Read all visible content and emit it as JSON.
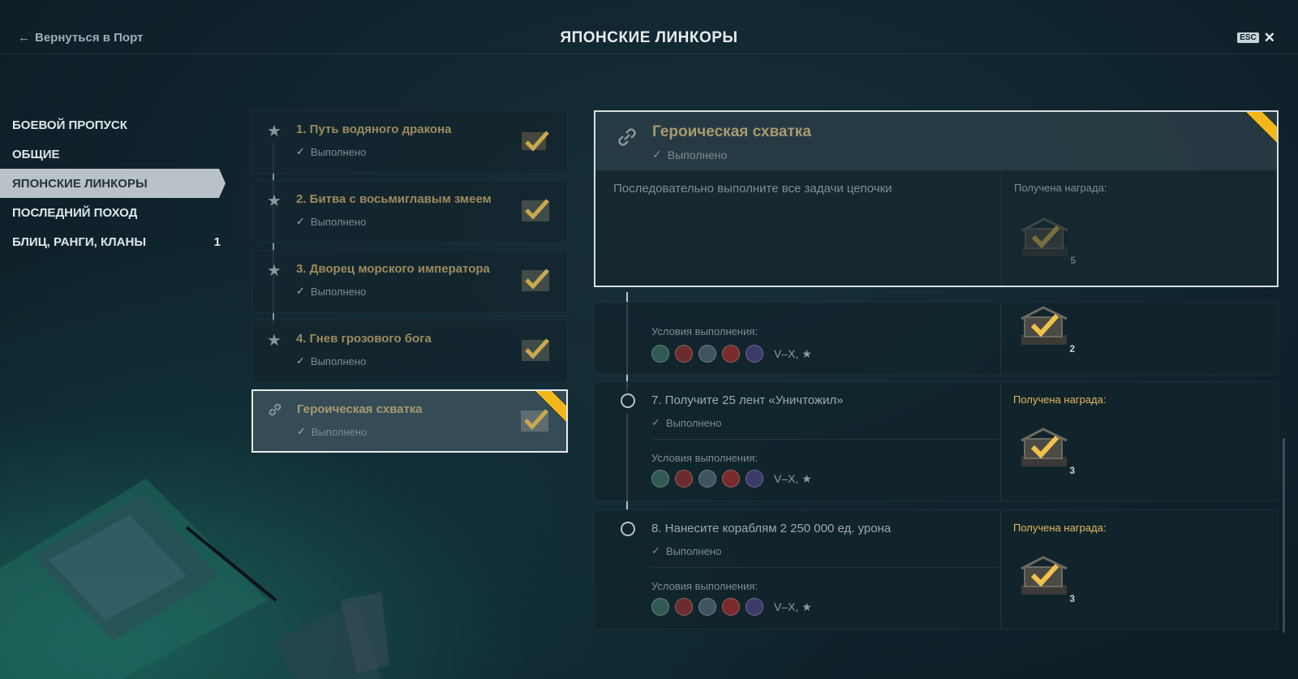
{
  "header": {
    "back_label": "Вернуться в Порт",
    "title": "ЯПОНСКИЕ ЛИНКОРЫ",
    "esc_label": "ESC"
  },
  "sidebar": {
    "items": [
      {
        "label": "БОЕВОЙ ПРОПУСК",
        "count": ""
      },
      {
        "label": "ОБЩИЕ",
        "count": ""
      },
      {
        "label": "ЯПОНСКИЕ ЛИНКОРЫ",
        "count": ""
      },
      {
        "label": "ПОСЛЕДНИЙ ПОХОД",
        "count": ""
      },
      {
        "label": "БЛИЦ, РАНГИ, КЛАНЫ",
        "count": "1"
      }
    ],
    "active_index": 2
  },
  "missions": [
    {
      "name": "1. Путь водяного дракона",
      "status": "Выполнено",
      "icon": "star-icon"
    },
    {
      "name": "2. Битва с восьмиглавым змеем",
      "status": "Выполнено",
      "icon": "star-icon"
    },
    {
      "name": "3. Дворец морского императора",
      "status": "Выполнено",
      "icon": "star-icon"
    },
    {
      "name": "4. Гнев грозового бога",
      "status": "Выполнено",
      "icon": "star-icon"
    },
    {
      "name": "Героическая схватка",
      "status": "Выполнено",
      "icon": "link-icon"
    }
  ],
  "detail": {
    "name": "Героическая схватка",
    "status": "Выполнено",
    "description": "Последовательно выполните все задачи цепочки",
    "reward_label": "Получена награда:",
    "reward_count": "5"
  },
  "tasks": [
    {
      "name": "",
      "status": "",
      "conditions_label": "Условия выполнения:",
      "tiers": "V–X, ★",
      "reward_label": "",
      "reward_count": "2"
    },
    {
      "name": "7. Получите 25 лент «Уничтожил»",
      "status": "Выполнено",
      "conditions_label": "Условия выполнения:",
      "tiers": "V–X, ★",
      "reward_label": "Получена награда:",
      "reward_count": "3"
    },
    {
      "name": "8. Нанесите кораблям 2 250 000 ед. урона",
      "status": "Выполнено",
      "conditions_label": "Условия выполнения:",
      "tiers": "V–X, ★",
      "reward_label": "Получена награда:",
      "reward_count": "3"
    }
  ],
  "colors": {
    "accent_gold": "#f2b71a",
    "reward_label": "#e3b95b",
    "mission_name": "#9c8b5d"
  }
}
